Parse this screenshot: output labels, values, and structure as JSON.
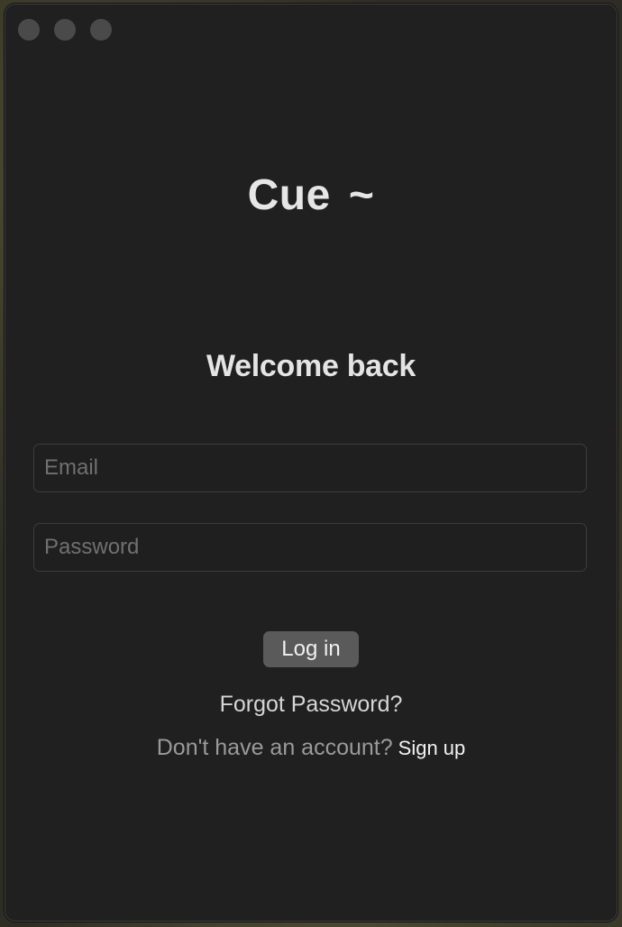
{
  "app": {
    "logo_text": "Cue",
    "logo_mark": "~"
  },
  "login": {
    "heading": "Welcome back",
    "email_placeholder": "Email",
    "email_value": "",
    "password_placeholder": "Password",
    "password_value": "",
    "submit_label": "Log in",
    "forgot_label": "Forgot Password?",
    "signup_prompt": "Don't have an account?",
    "signup_label": "Sign up"
  },
  "window": {
    "controls": [
      "close",
      "minimize",
      "zoom"
    ]
  }
}
